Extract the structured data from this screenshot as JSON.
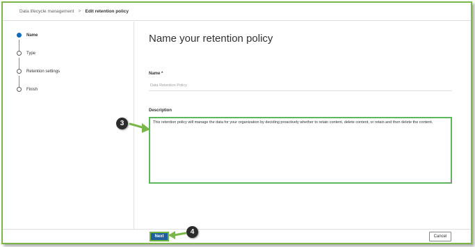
{
  "breadcrumb": {
    "root": "Data lifecycle management",
    "separator": ">",
    "current": "Edit retention policy"
  },
  "steps": [
    {
      "label": "Name",
      "active": true
    },
    {
      "label": "Type",
      "active": false
    },
    {
      "label": "Retention settings",
      "active": false
    },
    {
      "label": "Finish",
      "active": false
    }
  ],
  "main": {
    "title": "Name your retention policy",
    "name_label": "Name *",
    "name_placeholder": "Data Retention Policy",
    "description_label": "Description",
    "description_value": "This retention policy will manage the data for your organization by deciding proactively whether to retain content, delete content, or retain and then delete the content."
  },
  "footer": {
    "next_label": "Next",
    "cancel_label": "Cancel"
  },
  "callouts": [
    {
      "number": "3",
      "target": "description-field"
    },
    {
      "number": "4",
      "target": "next-button"
    }
  ],
  "colors": {
    "highlight": "#7ab648",
    "active_step": "#0f6cbd",
    "primary_button": "#1f5f9e",
    "callout_bg": "#2b2b2b"
  }
}
